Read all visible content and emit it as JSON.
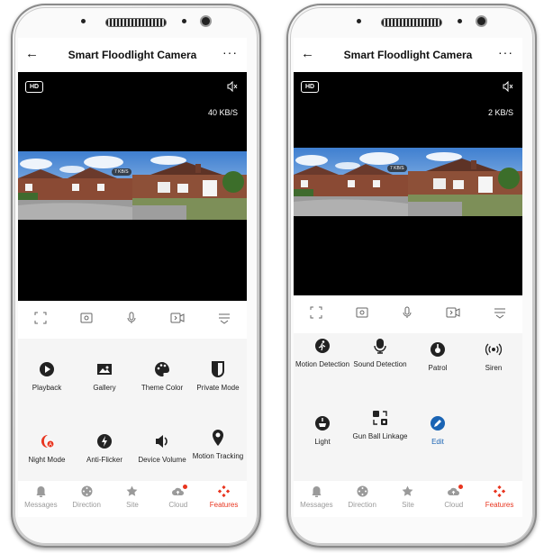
{
  "colors": {
    "accent": "#e8351f",
    "edit_blue": "#1a64b4",
    "inactive": "#9a9a9a",
    "video_bg": "#000000"
  },
  "left": {
    "header": {
      "title": "Smart Floodlight Camera",
      "back_icon": "arrow-left-icon",
      "more_icon": "more-dots-icon",
      "more_glyph": "···"
    },
    "video": {
      "hd_label": "HD",
      "bitrate": "40 KB/S",
      "feed_bitrate": "7 KB/S"
    },
    "features": [
      {
        "label": "Playback",
        "icon": "play-circle-icon"
      },
      {
        "label": "Gallery",
        "icon": "image-icon"
      },
      {
        "label": "Theme Color",
        "icon": "palette-icon"
      },
      {
        "label": "Private Mode",
        "icon": "shield-half-icon"
      },
      {
        "label": "Night Mode",
        "icon": "night-mode-icon"
      },
      {
        "label": "Anti-Flicker",
        "icon": "bolt-icon"
      },
      {
        "label": "Device Volume",
        "icon": "volume-icon"
      },
      {
        "label": "Motion Tracking",
        "icon": "location-pin-icon"
      }
    ],
    "tabs": [
      {
        "label": "Messages",
        "icon": "bell-icon"
      },
      {
        "label": "Direction",
        "icon": "joystick-icon"
      },
      {
        "label": "Site",
        "icon": "star-icon"
      },
      {
        "label": "Cloud",
        "icon": "cloud-icon"
      },
      {
        "label": "Features",
        "icon": "features-icon"
      }
    ]
  },
  "right": {
    "header": {
      "title": "Smart Floodlight Camera",
      "back_icon": "arrow-left-icon",
      "more_icon": "more-dots-icon",
      "more_glyph": "···"
    },
    "video": {
      "hd_label": "HD",
      "bitrate": "2 KB/S",
      "feed_bitrate": "7 KB/S"
    },
    "features": [
      {
        "label": "Motion Detection",
        "icon": "motion-person-icon"
      },
      {
        "label": "Sound Detection",
        "icon": "microphone-icon"
      },
      {
        "label": "Patrol",
        "icon": "patrol-icon"
      },
      {
        "label": "Siren",
        "icon": "siren-icon"
      },
      {
        "label": "Light",
        "icon": "light-icon"
      },
      {
        "label": "Gun Ball Linkage",
        "icon": "linkage-icon"
      },
      {
        "label": "Edit",
        "icon": "edit-pencil-icon"
      }
    ],
    "tabs": [
      {
        "label": "Messages",
        "icon": "bell-icon"
      },
      {
        "label": "Direction",
        "icon": "joystick-icon"
      },
      {
        "label": "Site",
        "icon": "star-icon"
      },
      {
        "label": "Cloud",
        "icon": "cloud-icon"
      },
      {
        "label": "Features",
        "icon": "features-icon"
      }
    ]
  }
}
